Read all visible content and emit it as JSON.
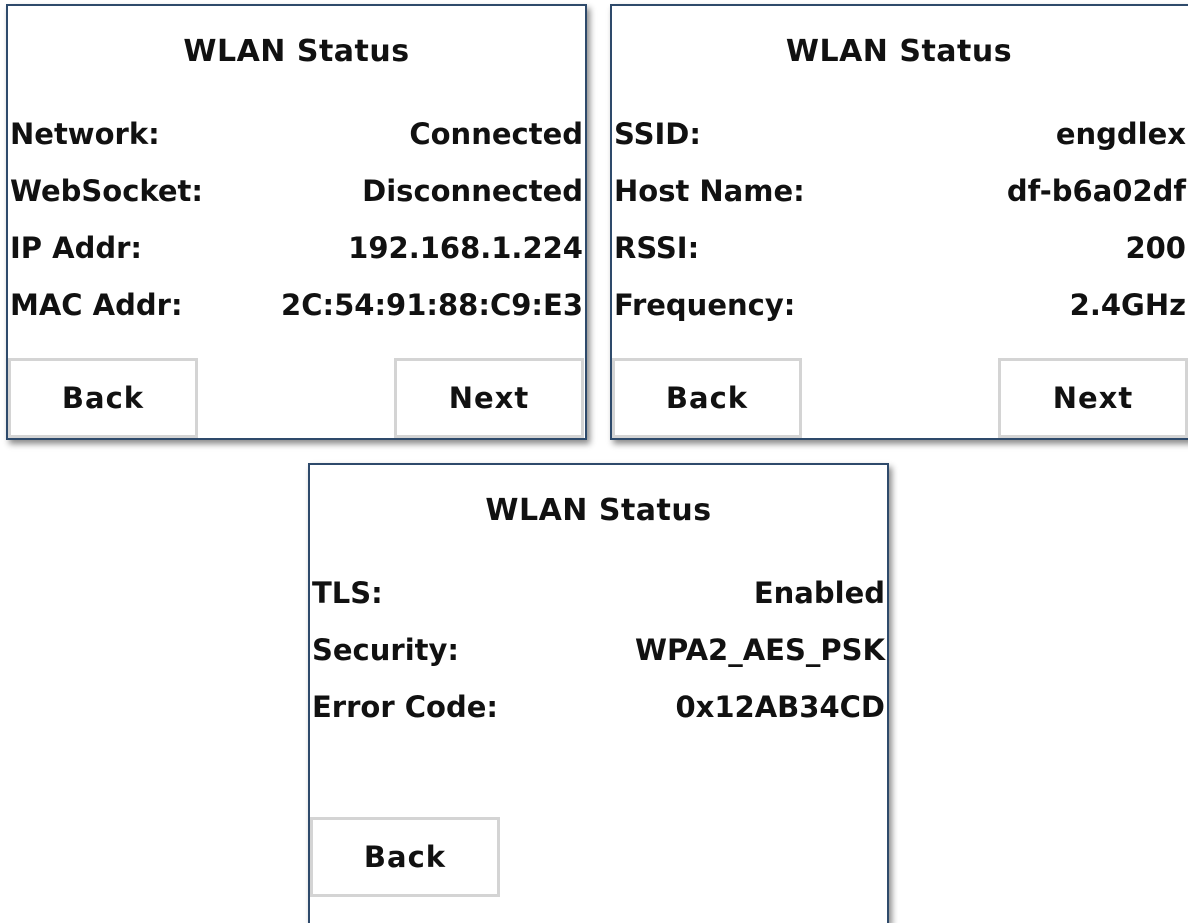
{
  "screens": [
    {
      "title": "WLAN Status",
      "rows": [
        {
          "label": "Network:",
          "value": "Connected"
        },
        {
          "label": "WebSocket:",
          "value": "Disconnected"
        },
        {
          "label": "IP Addr:",
          "value": "192.168.1.224"
        },
        {
          "label": "MAC Addr:",
          "value": "2C:54:91:88:C9:E3"
        }
      ],
      "back_label": "Back",
      "next_label": "Next"
    },
    {
      "title": "WLAN Status",
      "rows": [
        {
          "label": "SSID:",
          "value": "engdlex"
        },
        {
          "label": "Host Name:",
          "value": "df-b6a02df"
        },
        {
          "label": "RSSI:",
          "value": "200"
        },
        {
          "label": "Frequency:",
          "value": "2.4GHz"
        }
      ],
      "back_label": "Back",
      "next_label": "Next"
    },
    {
      "title": "WLAN Status",
      "rows": [
        {
          "label": "TLS:",
          "value": "Enabled"
        },
        {
          "label": "Security:",
          "value": "WPA2_AES_PSK"
        },
        {
          "label": "Error Code:",
          "value": "0x12AB34CD"
        }
      ],
      "back_label": "Back"
    }
  ],
  "colors": {
    "border": "#2e4a6b",
    "button_border": "#d4d4d4",
    "text": "#111111",
    "background": "#ffffff"
  }
}
